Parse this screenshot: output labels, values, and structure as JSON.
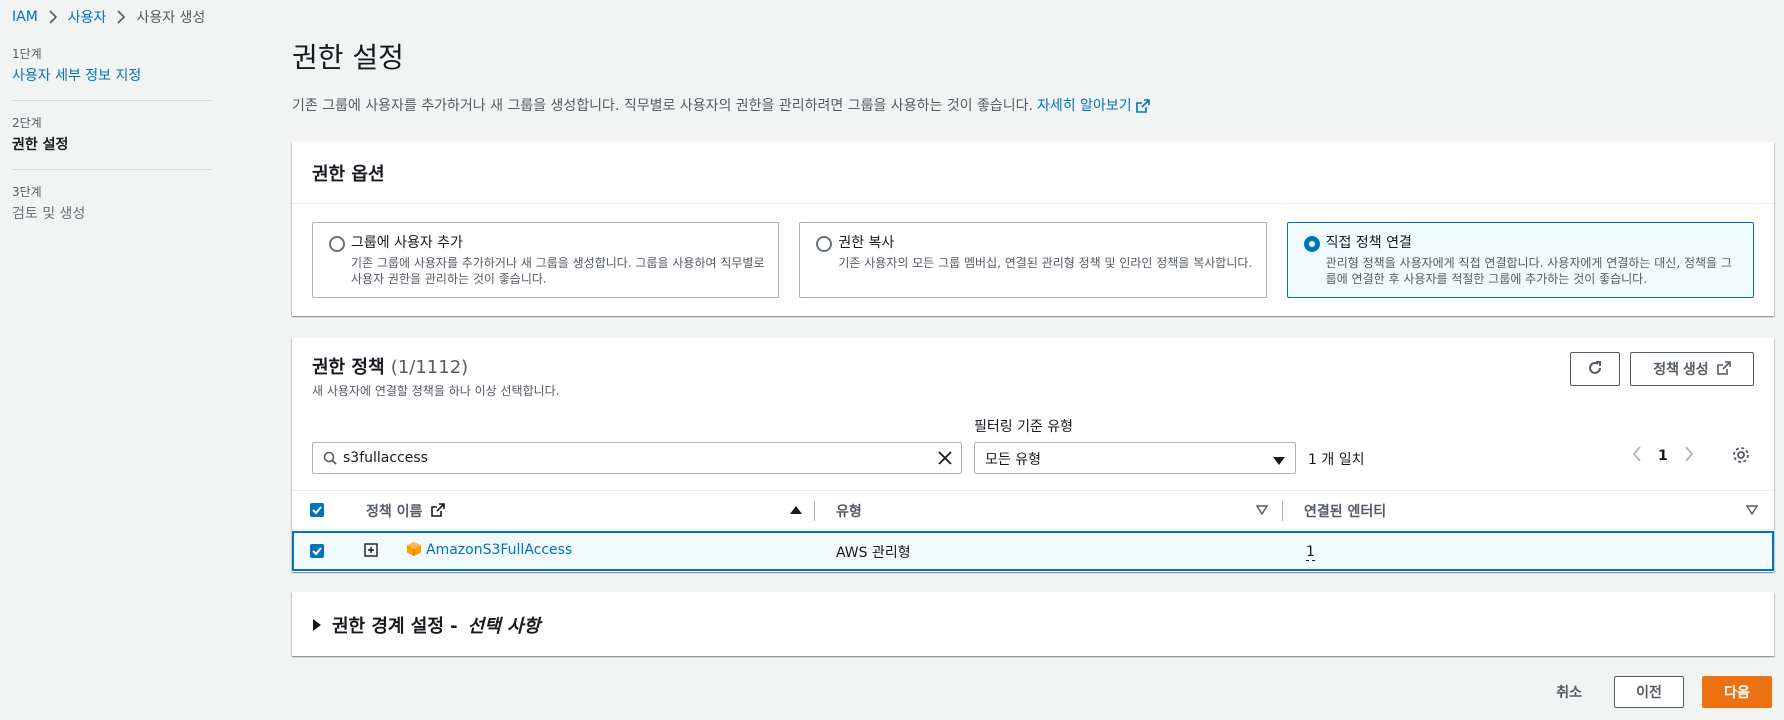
{
  "breadcrumb": {
    "items": [
      "IAM",
      "사용자"
    ],
    "current": "사용자 생성"
  },
  "steps": [
    {
      "num": "1단계",
      "label": "사용자 세부 정보 지정"
    },
    {
      "num": "2단계",
      "label": "권한 설정"
    },
    {
      "num": "3단계",
      "label": "검토 및 생성"
    }
  ],
  "page": {
    "title": "권한 설정",
    "description": "기존 그룹에 사용자를 추가하거나 새 그룹을 생성합니다. 직무별로 사용자의 권한을 관리하려면 그룹을 사용하는 것이 좋습니다.",
    "learn_more": "자세히 알아보기"
  },
  "options": {
    "header": "권한 옵션",
    "tiles": [
      {
        "title": "그룹에 사용자 추가",
        "desc": "기존 그룹에 사용자를 추가하거나 새 그룹을 생성합니다. 그룹을 사용하여 직무별로 사용자 권한을 관리하는 것이 좋습니다."
      },
      {
        "title": "권한 복사",
        "desc": "기존 사용자의 모든 그룹 멤버십, 연결된 관리형 정책 및 인라인 정책을 복사합니다."
      },
      {
        "title": "직접 정책 연결",
        "desc": "관리형 정책을 사용자에게 직접 연결합니다. 사용자에게 연결하는 대신, 정책을 그룹에 연결한 후 사용자를 적절한 그룹에 추가하는 것이 좋습니다."
      }
    ],
    "selected_index": 2
  },
  "policies": {
    "title": "권한 정책",
    "count": "(1/1112)",
    "subtitle": "새 사용자에 연결할 정책을 하나 이상 선택합니다.",
    "create_button": "정책 생성",
    "search_value": "s3fullaccess",
    "filter_label": "필터링 기준 유형",
    "filter_value": "모든 유형",
    "match_text": "1 개 일치",
    "page_number": "1",
    "columns": [
      "정책 이름",
      "유형",
      "연결된 엔터티"
    ],
    "rows": [
      {
        "name": "AmazonS3FullAccess",
        "type": "AWS 관리형",
        "entities": "1",
        "checked": true
      }
    ]
  },
  "boundary": {
    "title": "권한 경계 설정 -",
    "optional": "선택 사항"
  },
  "footer": {
    "cancel": "취소",
    "previous": "이전",
    "next": "다음"
  },
  "colors": {
    "link": "#0073bb",
    "primary": "#ec7211",
    "selected_bg": "#f1faff"
  }
}
